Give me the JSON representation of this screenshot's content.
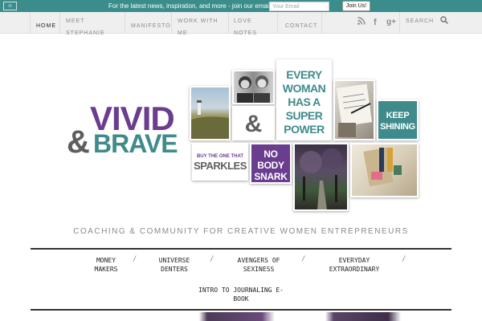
{
  "banner": {
    "message": "For the latest news, inspiration, and more - join our email list!",
    "email_placeholder": "Your Email",
    "join_label": "Join Us!",
    "logo_glyph": "✉",
    "color": "#3b8d8c"
  },
  "nav": {
    "home": "HOME",
    "meet": "MEET STEPHANIE",
    "manifesto": "MANIFESTO",
    "work": "WORK WITH ME",
    "love": "LOVE NOTES",
    "contact": "CONTACT",
    "search_label": "SEARCH",
    "icons": [
      "rss-icon",
      "facebook-icon",
      "google-plus-icon",
      "search-icon"
    ]
  },
  "logo": {
    "vivid": "VIVID",
    "amp": "&",
    "brave": "BRAVE",
    "colors": {
      "vivid": "#6a3d8f",
      "amp": "#5e5e5e",
      "brave": "#3f8b8b"
    }
  },
  "collage": {
    "amp": "&",
    "every": [
      "EVERY",
      "WOMAN",
      "HAS A",
      "SUPER",
      "POWER"
    ],
    "keep": [
      "KEEP",
      "SHINING"
    ],
    "sparkles_line1": "BUY THE ONE THAT",
    "sparkles_line2": "SPARKLES",
    "nobody": [
      "NO",
      "BODY",
      "SNARK"
    ]
  },
  "tagline": "COACHING & COMMUNITY FOR CREATIVE WOMEN ENTREPRENEURS",
  "bottom_nav": [
    {
      "line1": "MONEY",
      "line2": "MAKERS"
    },
    {
      "line1": "UNIVERSE",
      "line2": "DENTERS"
    },
    {
      "line1": "AVENGERS OF",
      "line2": "SEXINESS"
    },
    {
      "line1": "EVERYDAY",
      "line2": "EXTRAORDINARY"
    },
    {
      "line1": "INTRO TO JOURNALING E-",
      "line2": "BOOK"
    }
  ],
  "separator": "/"
}
